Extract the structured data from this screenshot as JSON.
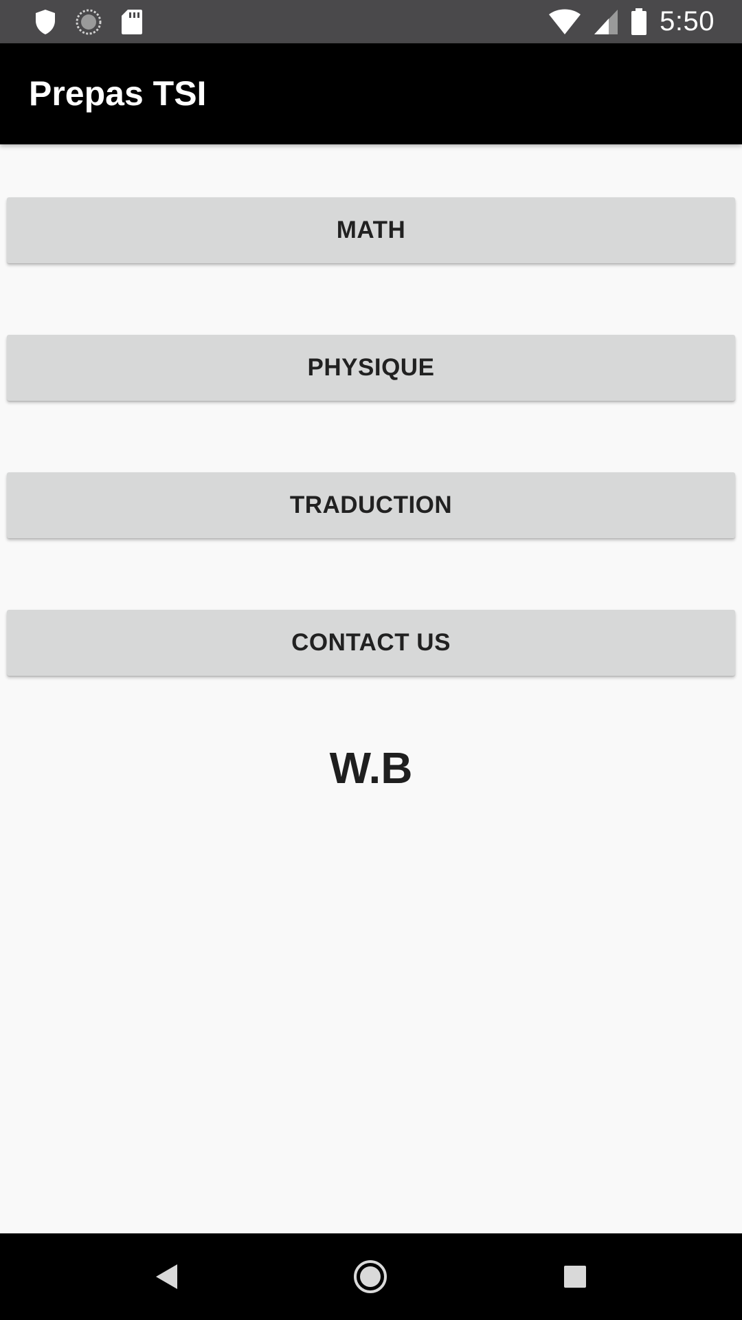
{
  "status_bar": {
    "time": "5:50",
    "left_icons": [
      "shield-icon",
      "sync-icon",
      "sd-card-icon"
    ],
    "right_icons": [
      "wifi-icon",
      "cell-signal-icon",
      "battery-icon"
    ]
  },
  "app_bar": {
    "title": "Prepas TSI"
  },
  "buttons": [
    {
      "label": "MATH"
    },
    {
      "label": "PHYSIQUE"
    },
    {
      "label": "TRADUCTION"
    },
    {
      "label": "CONTACT US"
    }
  ],
  "footer": {
    "text": "W.B"
  },
  "nav_bar": {
    "icons": [
      "back-icon",
      "home-icon",
      "recents-icon"
    ]
  },
  "colors": {
    "status_bar": "#4a494b",
    "app_bar": "#000000",
    "background": "#f9f9f9",
    "button": "#d7d8d8",
    "button_text": "#212121"
  }
}
